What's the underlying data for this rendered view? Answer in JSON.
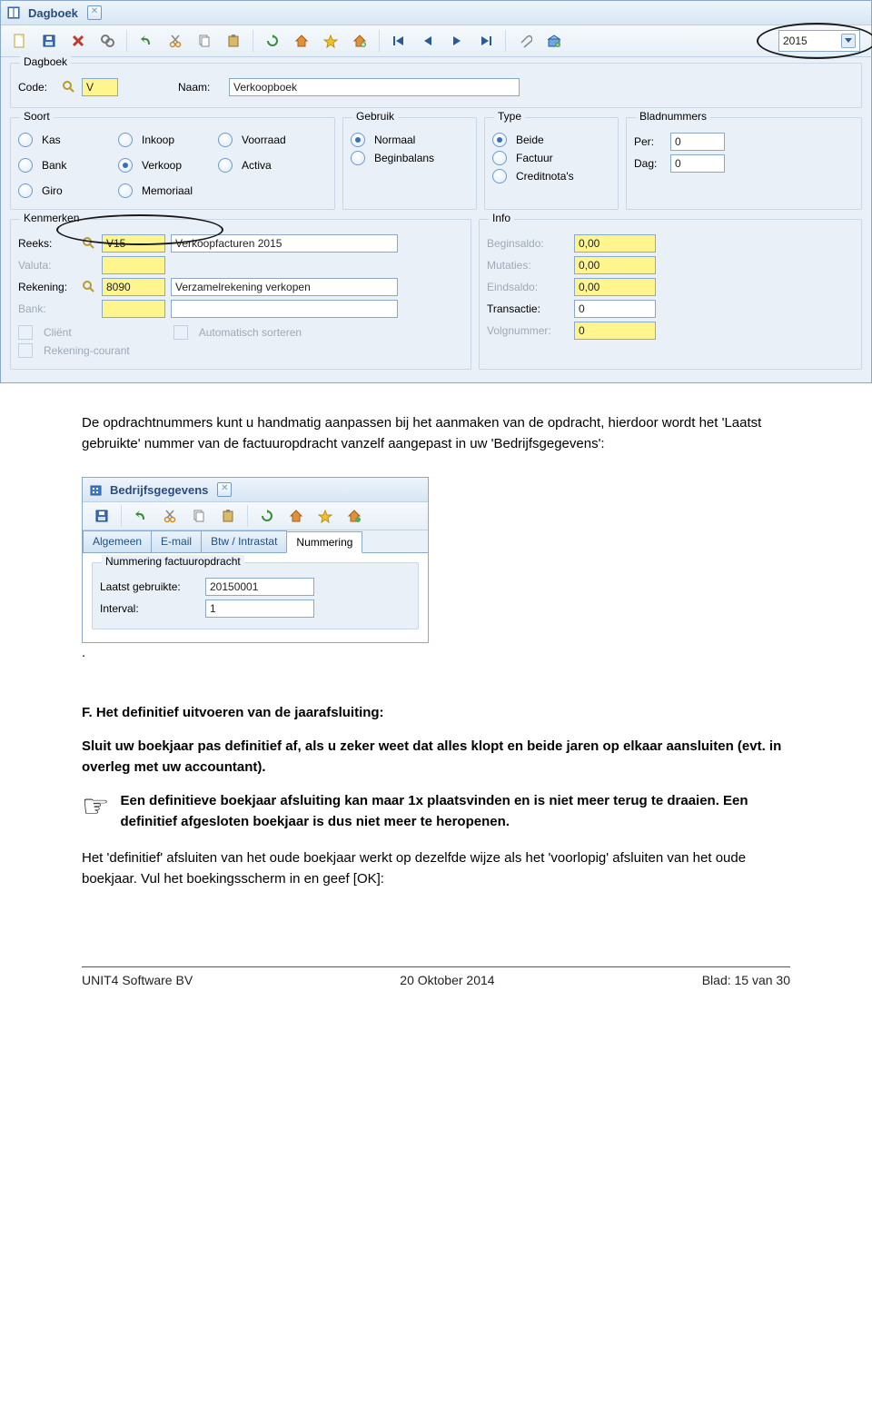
{
  "window1": {
    "title": "Dagboek",
    "year": "2015",
    "dagboek": {
      "sectionTitle": "Dagboek",
      "codeLabel": "Code:",
      "codeValue": "V",
      "naamLabel": "Naam:",
      "naamValue": "Verkoopboek"
    },
    "soort": {
      "title": "Soort",
      "options": [
        "Kas",
        "Bank",
        "Giro",
        "Inkoop",
        "Verkoop",
        "Memoriaal",
        "Voorraad",
        "Activa"
      ],
      "selected": "Verkoop"
    },
    "gebruik": {
      "title": "Gebruik",
      "options": [
        "Normaal",
        "Beginbalans"
      ],
      "selected": "Normaal"
    },
    "type": {
      "title": "Type",
      "options": [
        "Beide",
        "Factuur",
        "Creditnota's"
      ],
      "selected": "Beide"
    },
    "bladnummers": {
      "title": "Bladnummers",
      "perLabel": "Per:",
      "perValue": "0",
      "dagLabel": "Dag:",
      "dagValue": "0"
    },
    "kenmerken": {
      "title": "Kenmerken",
      "reeksLabel": "Reeks:",
      "reeksCode": "V15",
      "reeksDesc": "Verkoopfacturen 2015",
      "valutaLabel": "Valuta:",
      "rekeningLabel": "Rekening:",
      "rekeningCode": "8090",
      "rekeningDesc": "Verzamelrekening verkopen",
      "bankLabel": "Bank:",
      "clientLabel": "Cliënt",
      "autosortLabel": "Automatisch sorteren",
      "rcLabel": "Rekening-courant"
    },
    "info": {
      "title": "Info",
      "beginsaldoLabel": "Beginsaldo:",
      "beginsaldoValue": "0,00",
      "mutatiesLabel": "Mutaties:",
      "mutatiesValue": "0,00",
      "eindsaldoLabel": "Eindsaldo:",
      "eindsaldoValue": "0,00",
      "transactieLabel": "Transactie:",
      "transactieValue": "0",
      "volgnummerLabel": "Volgnummer:",
      "volgnummerValue": "0"
    }
  },
  "doc": {
    "p1": "De opdrachtnummers kunt u handmatig aanpassen bij het aanmaken van de opdracht, hierdoor wordt het 'Laatst gebruikte' nummer van de factuuropdracht vanzelf aangepast in uw 'Bedrijfsgegevens':",
    "fHeading": "F. Het definitief uitvoeren van de jaarafsluiting:",
    "fBody": "Sluit uw boekjaar pas definitief af, als u zeker weet dat alles klopt en beide jaren op elkaar aansluiten (evt. in overleg met uw accountant).",
    "noteLine1": "Een definitieve boekjaar afsluiting kan maar 1x plaatsvinden en is niet meer terug te draaien. Een definitief afgesloten boekjaar is dus niet meer te heropenen.",
    "p3": "Het 'definitief' afsluiten van het oude boekjaar werkt op dezelfde wijze als het 'voorlopig' afsluiten van het oude boekjaar. Vul het boekingsscherm in en geef [OK]:"
  },
  "window2": {
    "title": "Bedrijfsgegevens",
    "tabs": [
      "Algemeen",
      "E-mail",
      "Btw / Intrastat",
      "Nummering"
    ],
    "activeTab": "Nummering",
    "sectionTitle": "Nummering factuuropdracht",
    "laatstLabel": "Laatst gebruikte:",
    "laatstValue": "20150001",
    "intervalLabel": "Interval:",
    "intervalValue": "1"
  },
  "footer": {
    "left": "UNIT4 Software BV",
    "center": "20 Oktober 2014",
    "right": "Blad: 15 van 30"
  }
}
